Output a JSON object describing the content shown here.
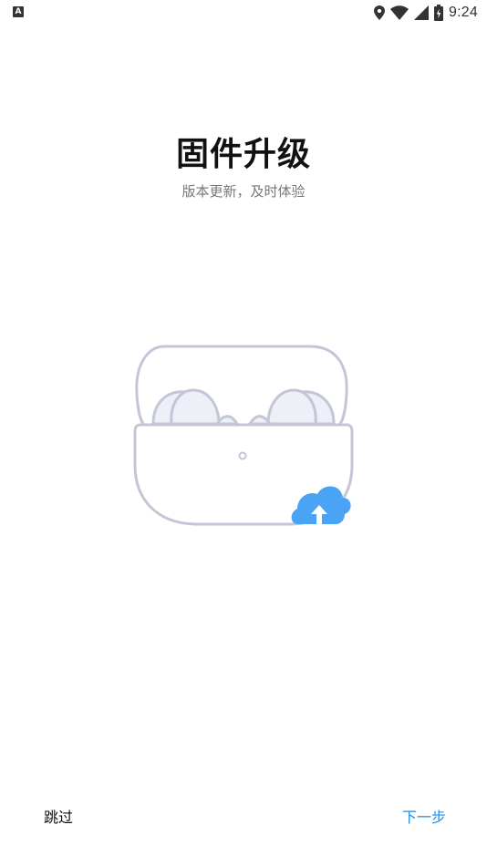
{
  "status_bar": {
    "notification_letter": "A",
    "time": "9:24",
    "icons": [
      "location-icon",
      "wifi-icon",
      "cell-signal-icon",
      "battery-icon"
    ]
  },
  "page": {
    "title": "固件升级",
    "subtitle": "版本更新，及时体验"
  },
  "illustration": {
    "icon_name": "earbuds-case-illustration",
    "badge_icon": "cloud-upload-icon",
    "badge_color": "#4aa3f5",
    "outline_color": "#c3c6d6",
    "fill_color": "#eef0f7"
  },
  "footer": {
    "skip_label": "跳过",
    "next_label": "下一步",
    "next_color": "#1f8fe6"
  }
}
